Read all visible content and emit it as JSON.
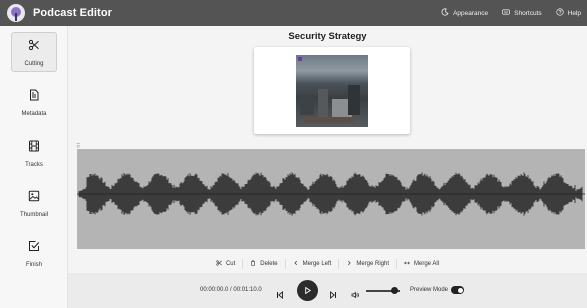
{
  "header": {
    "title": "Podcast Editor",
    "actions": [
      {
        "label": "Appearance",
        "icon": "moon-icon"
      },
      {
        "label": "Shortcuts",
        "icon": "keyboard-icon"
      },
      {
        "label": "Help",
        "icon": "help-icon"
      }
    ]
  },
  "sidebar": {
    "items": [
      {
        "label": "Cutting",
        "icon": "scissors-icon",
        "active": true
      },
      {
        "label": "Metadata",
        "icon": "document-icon",
        "active": false
      },
      {
        "label": "Tracks",
        "icon": "film-icon",
        "active": false
      },
      {
        "label": "Thumbnail",
        "icon": "image-icon",
        "active": false
      },
      {
        "label": "Finish",
        "icon": "checkbox-icon",
        "active": false
      }
    ]
  },
  "main": {
    "project_title": "Security Strategy",
    "thumbnail_badge": "",
    "toolbar": [
      {
        "label": "Cut",
        "icon": "scissors-icon"
      },
      {
        "label": "Delete",
        "icon": "trash-icon"
      },
      {
        "label": "Merge Left",
        "icon": "chevron-left-icon"
      },
      {
        "label": "Merge Right",
        "icon": "chevron-right-icon"
      },
      {
        "label": "Merge All",
        "icon": "merge-arrows-icon"
      }
    ],
    "player": {
      "time": "00:00:00.0 / 00:01:10.0",
      "volume": 0.85,
      "preview_mode_label": "Preview Mode",
      "preview_mode_on": true
    }
  },
  "colors": {
    "header_bg": "#545454",
    "waveform_bg": "#b4b4b4",
    "waveform": "#1f1f1f",
    "accent": "#6b3fa0"
  }
}
